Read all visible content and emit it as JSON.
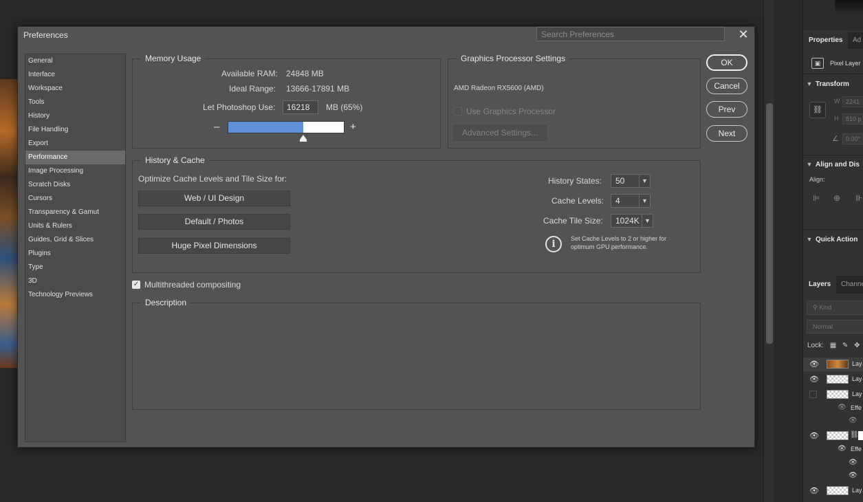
{
  "dialog": {
    "title": "Preferences",
    "search_placeholder": "Search Preferences",
    "close_glyph": "✕"
  },
  "categories": [
    "General",
    "Interface",
    "Workspace",
    "Tools",
    "History",
    "File Handling",
    "Export",
    "Performance",
    "Image Processing",
    "Scratch Disks",
    "Cursors",
    "Transparency & Gamut",
    "Units & Rulers",
    "Guides, Grid & Slices",
    "Plugins",
    "Type",
    "3D",
    "Technology Previews"
  ],
  "selected_category": "Performance",
  "memory": {
    "title": "Memory Usage",
    "available_label": "Available RAM:",
    "available_value": "24848 MB",
    "ideal_label": "Ideal Range:",
    "ideal_value": "13666-17891 MB",
    "use_label": "Let Photoshop Use:",
    "use_value": "16218",
    "use_suffix": "MB (65%)",
    "fill_percent": 65,
    "minus": "–",
    "plus": "+"
  },
  "gpu": {
    "title": "Graphics Processor Settings",
    "card": "AMD Radeon RX5600 (AMD)",
    "use_label": "Use Graphics Processor",
    "advanced_label": "Advanced Settings..."
  },
  "history_cache": {
    "title": "History & Cache",
    "optimize_label": "Optimize Cache Levels and Tile Size for:",
    "buttons": [
      "Web / UI Design",
      "Default / Photos",
      "Huge Pixel Dimensions"
    ],
    "history_states_label": "History States:",
    "history_states_value": "50",
    "cache_levels_label": "Cache Levels:",
    "cache_levels_value": "4",
    "tile_size_label": "Cache Tile Size:",
    "tile_size_value": "1024K",
    "info_line1": "Set Cache Levels to 2 or higher for",
    "info_line2": "optimum GPU performance."
  },
  "multithreaded": {
    "label": "Multithreaded compositing",
    "checked": true
  },
  "description": {
    "title": "Description"
  },
  "actions": {
    "ok": "OK",
    "cancel": "Cancel",
    "prev": "Prev",
    "next": "Next"
  },
  "right_panel": {
    "tab_properties": "Properties",
    "tab_adjust": "Ad",
    "pixel_layer": "Pixel Layer",
    "transform": "Transform",
    "w_label": "W",
    "w_value": "2241",
    "h_label": "H",
    "h_value": "810 p",
    "angle_value": "0.00°",
    "align": "Align and Dis",
    "align_label": "Align:",
    "quick_actions": "Quick Action",
    "tab_layers": "Layers",
    "tab_channels": "Channe",
    "kind_placeholder": "Kind",
    "blend_mode": "Normal",
    "lock_label": "Lock:",
    "layer_name": "Lay",
    "effects": "Effe"
  }
}
